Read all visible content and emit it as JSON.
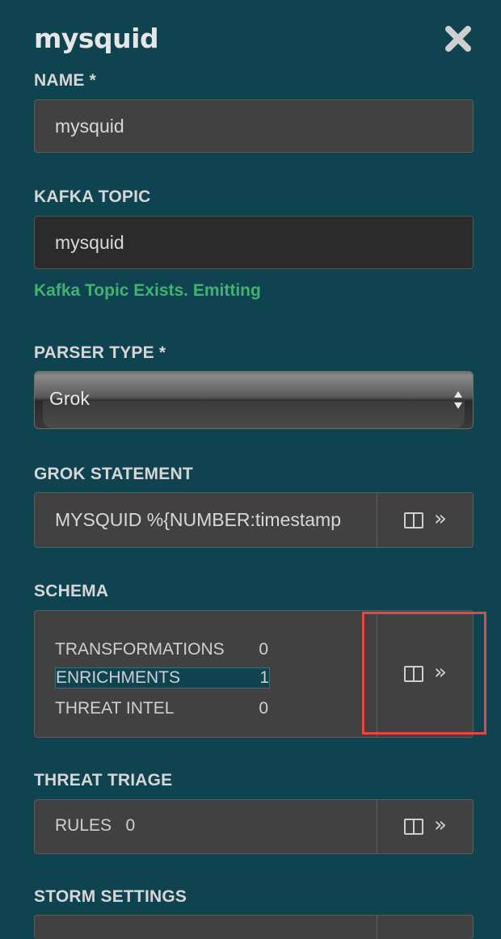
{
  "header": {
    "title": "mysquid"
  },
  "name": {
    "label": "NAME *",
    "value": "mysquid"
  },
  "kafka": {
    "label": "KAFKA TOPIC",
    "value": "mysquid",
    "status": "Kafka Topic Exists. Emitting"
  },
  "parser": {
    "label": "PARSER TYPE *",
    "value": "Grok"
  },
  "grok": {
    "label": "GROK STATEMENT",
    "value": "MYSQUID %{NUMBER:timestamp"
  },
  "schema": {
    "label": "SCHEMA",
    "rows": [
      {
        "name": "TRANSFORMATIONS",
        "count": "0"
      },
      {
        "name": "ENRICHMENTS",
        "count": "1"
      },
      {
        "name": "THREAT INTEL",
        "count": "0"
      }
    ]
  },
  "triage": {
    "label": "THREAT TRIAGE",
    "rules_label": "RULES",
    "rules_count": "0"
  },
  "storm": {
    "label": "STORM SETTINGS"
  },
  "icons": {
    "close": "close-icon",
    "panel": "split-panel-icon",
    "expand": "double-chevron-right-icon"
  },
  "colors": {
    "background": "#0f4350",
    "success": "#40b36e",
    "highlight": "#e84545"
  }
}
